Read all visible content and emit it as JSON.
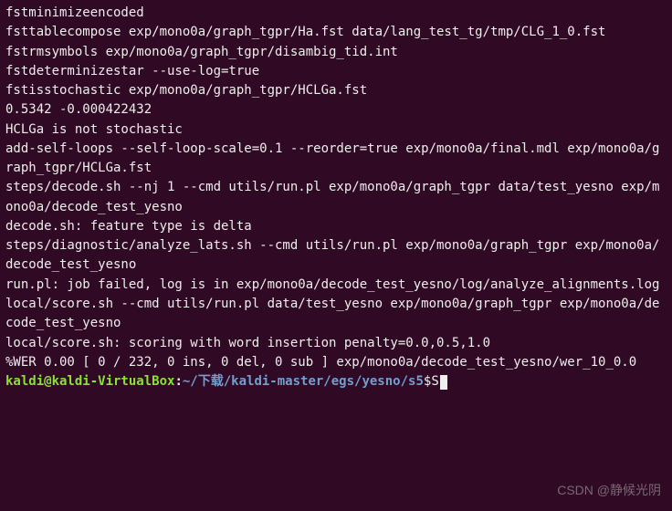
{
  "terminal": {
    "lines": [
      "fstminimizeencoded",
      "fsttablecompose exp/mono0a/graph_tgpr/Ha.fst data/lang_test_tg/tmp/CLG_1_0.fst",
      "fstrmsymbols exp/mono0a/graph_tgpr/disambig_tid.int",
      "fstdeterminizestar --use-log=true",
      "fstisstochastic exp/mono0a/graph_tgpr/HCLGa.fst",
      "0.5342 -0.000422432",
      "HCLGa is not stochastic",
      "add-self-loops --self-loop-scale=0.1 --reorder=true exp/mono0a/final.mdl exp/mono0a/graph_tgpr/HCLGa.fst",
      "steps/decode.sh --nj 1 --cmd utils/run.pl exp/mono0a/graph_tgpr data/test_yesno exp/mono0a/decode_test_yesno",
      "decode.sh: feature type is delta",
      "steps/diagnostic/analyze_lats.sh --cmd utils/run.pl exp/mono0a/graph_tgpr exp/mono0a/decode_test_yesno",
      "run.pl: job failed, log is in exp/mono0a/decode_test_yesno/log/analyze_alignments.log",
      "local/score.sh --cmd utils/run.pl data/test_yesno exp/mono0a/graph_tgpr exp/mono0a/decode_test_yesno",
      "local/score.sh: scoring with word insertion penalty=0.0,0.5,1.0",
      "%WER 0.00 [ 0 / 232, 0 ins, 0 del, 0 sub ] exp/mono0a/decode_test_yesno/wer_10_0.0"
    ],
    "prompt": {
      "user_host": "kaldi@kaldi-VirtualBox",
      "colon": ":",
      "path": "~/下载/kaldi-master/egs/yesno/s5",
      "dollar": "$ ",
      "typed": "S"
    }
  },
  "watermark": "CSDN @静候光阴"
}
